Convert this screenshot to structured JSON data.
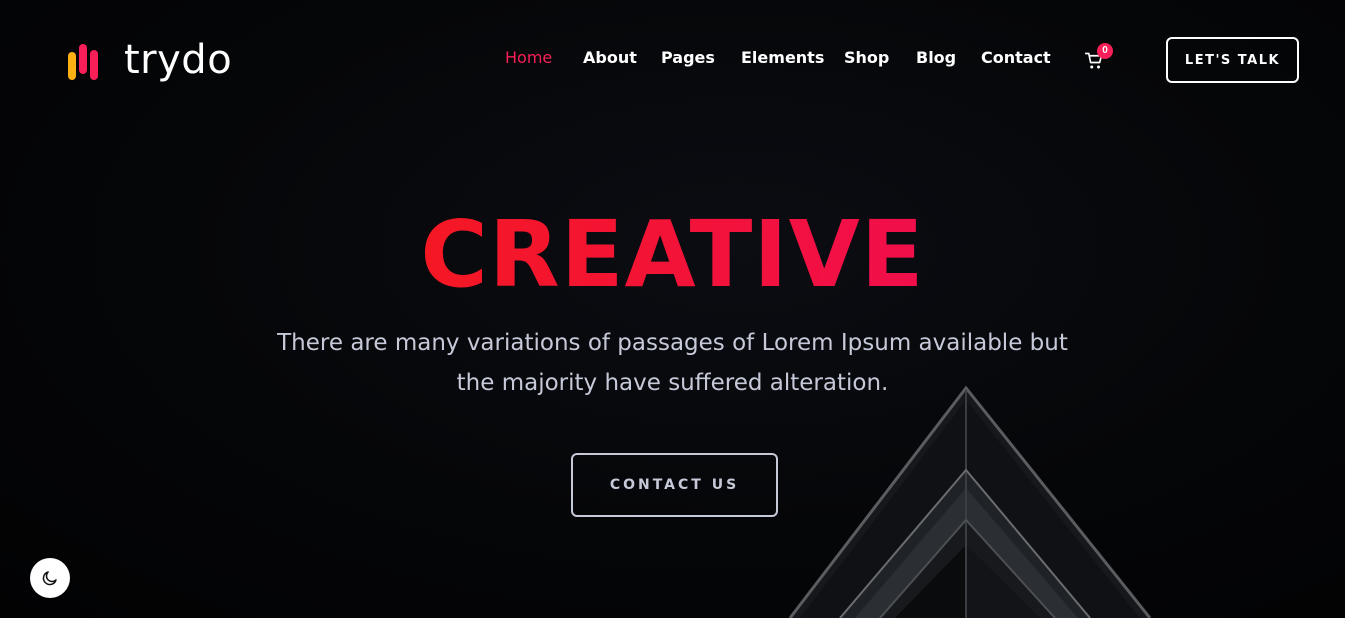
{
  "brand": {
    "name": "trydo",
    "bar_colors": [
      "#fbb014",
      "#f81f58",
      "#f81f58"
    ]
  },
  "nav": {
    "items": [
      {
        "label": "Home",
        "active": true
      },
      {
        "label": "About"
      },
      {
        "label": "Pages"
      },
      {
        "label": "Elements"
      },
      {
        "label": "Shop"
      },
      {
        "label": "Blog"
      },
      {
        "label": "Contact"
      }
    ],
    "cart": {
      "icon": "cart-icon",
      "count": "0"
    },
    "cta_label": "LET'S TALK"
  },
  "hero": {
    "title": "CREATIVE",
    "description_line1": "There are many variations of passages of Lorem Ipsum available but",
    "description_line2": "the majority have suffered alteration.",
    "button_label": "CONTACT US",
    "title_gradient": [
      "#f81f01",
      "#ee076e"
    ]
  },
  "theme_toggle": {
    "icon": "moon-icon"
  },
  "colors": {
    "accent": "#f81f58",
    "background": "#020203",
    "body_text": "#c6c9d8"
  }
}
